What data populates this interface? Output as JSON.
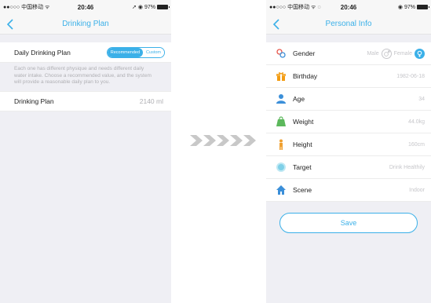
{
  "left_screen": {
    "status": {
      "carrier": "●●○○○ 中国移动 ᯤ",
      "time": "20:46",
      "battery": "➚ ◉ 97%"
    },
    "nav_title": "Drinking Plan",
    "daily_plan": {
      "label": "Daily Drinking Plan",
      "option_recommended": "Recommended",
      "option_custom": "Custom",
      "selected": "Recommended"
    },
    "description": "Each one has different physique and needs different daily water intake. Choose a recommended value, and the system will provide a reasonable daily plan to you.",
    "drinking_plan": {
      "label": "Drinking Plan",
      "value": "2140 ml"
    }
  },
  "arrows_glyph": "»»»»»",
  "right_screen": {
    "status": {
      "carrier": "●●○○○ 中国移动 ᯤ ◌",
      "time": "20:46",
      "battery": "◉ 97%"
    },
    "nav_title": "Personal Info",
    "rows": [
      {
        "label": "Gender",
        "value": "",
        "icon": "gender-icon",
        "color": "#e8564a"
      },
      {
        "label": "Birthday",
        "value": "1982-06-18",
        "icon": "gift-icon",
        "color": "#f39c12"
      },
      {
        "label": "Age",
        "value": "34",
        "icon": "person-icon",
        "color": "#3b8fd9"
      },
      {
        "label": "Weight",
        "value": "44.0kg",
        "icon": "weight-icon",
        "color": "#5cb85c"
      },
      {
        "label": "Height",
        "value": "160cm",
        "icon": "height-icon",
        "color": "#f0a030"
      },
      {
        "label": "Target",
        "value": "Drink Healthily",
        "icon": "target-icon",
        "color": "#7fd0e8"
      },
      {
        "label": "Scene",
        "value": "Indoor",
        "icon": "house-icon",
        "color": "#3b8fd9"
      }
    ],
    "gender": {
      "male_label": "Male",
      "female_label": "Female",
      "selected": "Female"
    },
    "save_label": "Save"
  },
  "colors": {
    "accent": "#3bb0e8",
    "background": "#efeff4",
    "muted_text": "#b0b0b4"
  }
}
